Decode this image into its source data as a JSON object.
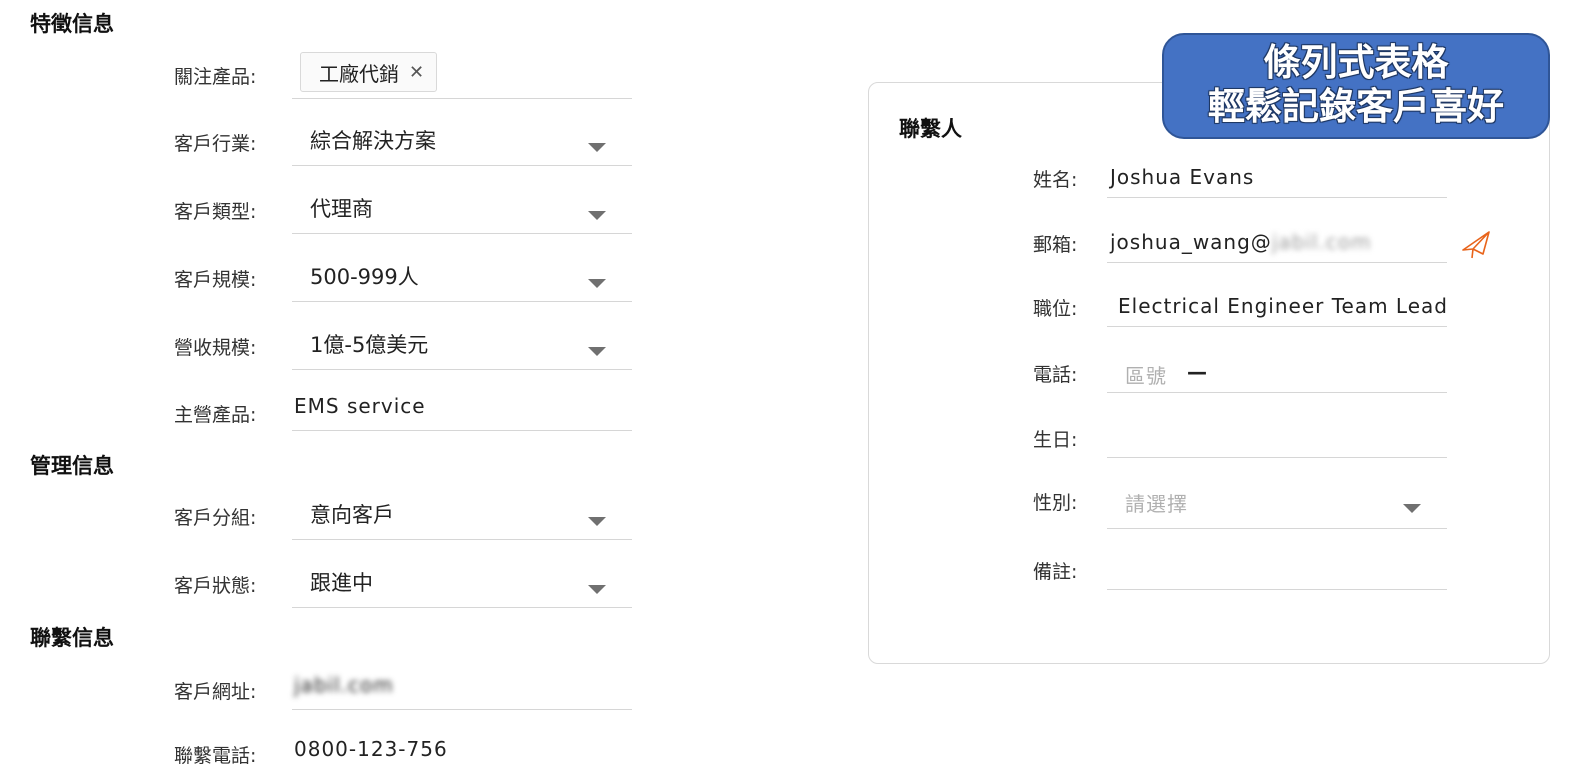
{
  "sections": {
    "features": {
      "title": "特徵信息",
      "focus_products": {
        "label": "關注產品:",
        "tags": [
          "工廠代銷"
        ],
        "remove_icon": "close-icon"
      },
      "industry": {
        "label": "客戶行業:",
        "value": "綜合解決方案"
      },
      "customer_type": {
        "label": "客戶類型:",
        "value": "代理商"
      },
      "customer_size": {
        "label": "客戶規模:",
        "value": "500-999人"
      },
      "revenue_size": {
        "label": "營收規模:",
        "value": "1億-5億美元"
      },
      "main_products": {
        "label": "主營產品:",
        "value": "EMS service"
      }
    },
    "management": {
      "title": "管理信息",
      "customer_group": {
        "label": "客戶分組:",
        "value": "意向客戶"
      },
      "customer_status": {
        "label": "客戶狀態:",
        "value": "跟進中"
      }
    },
    "contact_info": {
      "title": "聯繫信息",
      "website": {
        "label": "客戶網址:",
        "value": "jabil.com"
      },
      "phone": {
        "label": "聯繫電話:",
        "value": "0800-123-756"
      }
    }
  },
  "contact_card": {
    "title": "聯繫人",
    "name": {
      "label": "姓名:",
      "value": "Joshua Evans"
    },
    "email": {
      "label": "郵箱:",
      "value_visible": "joshua_wang@",
      "value_blurred": "jabil.com",
      "action_icon": "send-icon"
    },
    "position": {
      "label": "職位:",
      "value": "Electrical Engineer Team Lead"
    },
    "phone": {
      "label": "電話:",
      "area_code_placeholder": "區號",
      "separator": "—"
    },
    "birthday": {
      "label": "生日:",
      "value": ""
    },
    "gender": {
      "label": "性別:",
      "placeholder": "請選擇"
    },
    "notes": {
      "label": "備註:",
      "value": ""
    }
  },
  "banner": {
    "line1": "條列式表格",
    "line2": "輕鬆記錄客戶喜好",
    "color": "#4472c4"
  },
  "accent_colors": {
    "send_icon": "#e8641b"
  }
}
